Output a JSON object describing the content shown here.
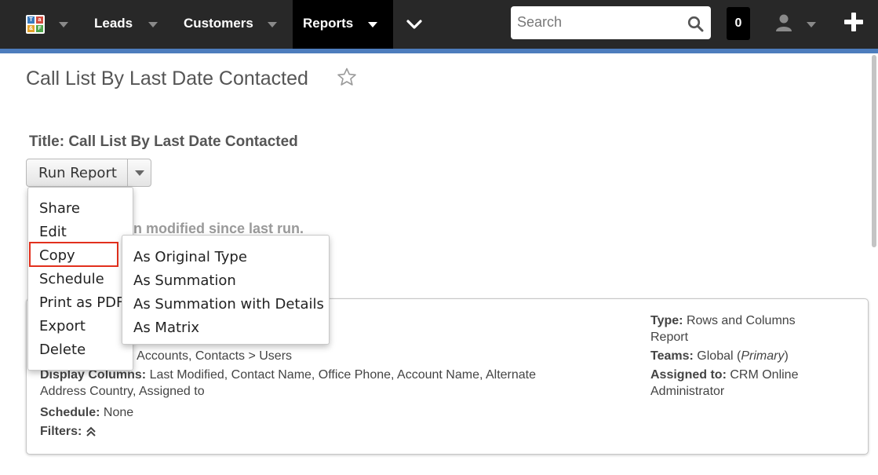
{
  "nav": {
    "logo_letters": [
      "T",
      "a",
      "&",
      "F"
    ],
    "links": [
      "Leads",
      "Customers",
      "Reports"
    ],
    "search_placeholder": "Search",
    "notification_count": "0"
  },
  "page": {
    "title": "Call List By Last Date Contacted",
    "report_title": "Title: Call List By Last Date Contacted",
    "run_report_label": "Run Report",
    "notice_text": "n modified since last run."
  },
  "action_menu": {
    "items": [
      "Share",
      "Edit",
      "Copy",
      "Schedule",
      "Print as PDF",
      "Export",
      "Delete"
    ]
  },
  "copy_submenu": {
    "items": [
      "As Original Type",
      "As Summation",
      "As Summation with Details",
      "As Matrix"
    ]
  },
  "details": {
    "modules_partial": "tacts, Contacts > Accounts, Contacts > Users",
    "display_columns_label": "Display Columns:",
    "display_columns_line1": "Last Modified, Contact Name, Office Phone, Account Name, Alternate",
    "display_columns_line2": "Address Country, Assigned to",
    "schedule_label": "Schedule:",
    "schedule_value": "None",
    "filters_label": "Filters:",
    "type_label": "Type:",
    "type_value_line1": "Rows and Columns",
    "type_value_line2": "Report",
    "teams_label": "Teams:",
    "teams_value": "Global (",
    "teams_primary": "Primary",
    "teams_close": ")",
    "assigned_label": "Assigned to:",
    "assigned_value_line1": "CRM Online",
    "assigned_value_line2": "Administrator"
  },
  "colors": {
    "nav_bg": "#282828",
    "accent": "#4d7dbd",
    "highlight": "#e2301d"
  }
}
